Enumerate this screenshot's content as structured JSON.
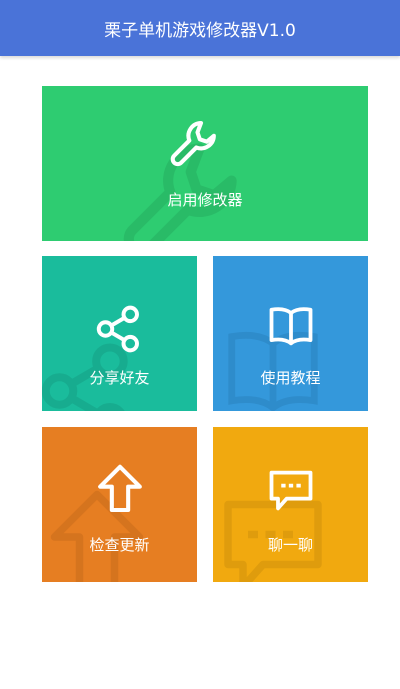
{
  "header": {
    "title": "栗子单机游戏修改器V1.0"
  },
  "tiles": {
    "modifier": {
      "label": "启用修改器",
      "icon": "wrench-icon",
      "color": "#2ecc71"
    },
    "share": {
      "label": "分享好友",
      "icon": "share-icon",
      "color": "#1abc9c"
    },
    "tutorial": {
      "label": "使用教程",
      "icon": "book-icon",
      "color": "#3498db"
    },
    "update": {
      "label": "检查更新",
      "icon": "arrow-up-icon",
      "color": "#e67e22"
    },
    "chat": {
      "label": "聊一聊",
      "icon": "chat-bubble-icon",
      "color": "#f1a90f"
    }
  },
  "colors": {
    "header": "#4a73d8",
    "background": "#ffffff"
  }
}
